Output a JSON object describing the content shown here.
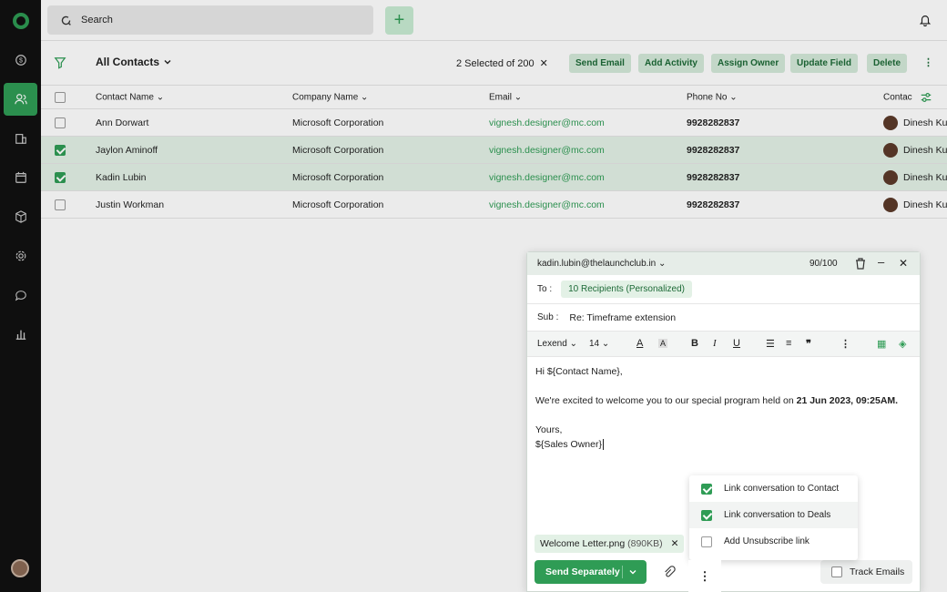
{
  "colors": {
    "accent": "#2f9c55",
    "sidebar": "#111111",
    "selected_row": "#e3f1e6"
  },
  "sidebar": {
    "items": [
      {
        "icon": "dollar-cycle-icon",
        "active": false
      },
      {
        "icon": "contacts-icon",
        "active": true
      },
      {
        "icon": "building-icon",
        "active": false
      },
      {
        "icon": "calendar-icon",
        "active": false
      },
      {
        "icon": "box-icon",
        "active": false
      },
      {
        "icon": "gear-icon",
        "active": false
      },
      {
        "icon": "chat-icon",
        "active": false
      },
      {
        "icon": "bar-chart-icon",
        "active": false
      }
    ]
  },
  "header": {
    "search_placeholder": "Search",
    "add_label": "+"
  },
  "toolbar": {
    "title": "All Contacts",
    "selection": "2 Selected of 200",
    "actions": [
      "Send Email",
      "Add Activity",
      "Assign Owner",
      "Update Field",
      "Delete"
    ]
  },
  "table": {
    "columns": [
      "Contact Name",
      "Company Name",
      "Email",
      "Phone No",
      "Contac"
    ],
    "rows": [
      {
        "name": "Ann Dorwart",
        "company": "Microsoft Corporation",
        "email": "vignesh.designer@mc.com",
        "phone": "9928282837",
        "owner": "Dinesh Ku",
        "checked": false
      },
      {
        "name": "Jaylon Aminoff",
        "company": "Microsoft Corporation",
        "email": "vignesh.designer@mc.com",
        "phone": "9928282837",
        "owner": "Dinesh Ku",
        "checked": true
      },
      {
        "name": "Kadin Lubin",
        "company": "Microsoft Corporation",
        "email": "vignesh.designer@mc.com",
        "phone": "9928282837",
        "owner": "Dinesh Ku",
        "checked": true
      },
      {
        "name": "Justin Workman",
        "company": "Microsoft Corporation",
        "email": "vignesh.designer@mc.com",
        "phone": "9928282837",
        "owner": "Dinesh Ku",
        "checked": false
      }
    ]
  },
  "compose": {
    "from": "kadin.lubin@thelaunchclub.in",
    "count": "90/100",
    "to_label": "To :",
    "recipients": "10 Recipients (Personalized)",
    "sub_label": "Sub :",
    "subject": "Re: Timeframe extension",
    "font": "Lexend",
    "size": "14",
    "greeting": "Hi ${Contact Name},",
    "line1": "We're excited to welcome you to our special program held on ",
    "line1_bold": "21 Jun 2023, 09:25AM.",
    "closing": "Yours,",
    "signature": "${Sales Owner}",
    "attachment": "Welcome Letter.png",
    "attachment_size": "(890KB)",
    "send_label": "Send Separately",
    "track_label": "Track Emails"
  },
  "popup": {
    "items": [
      {
        "label": "Link conversation to Contact",
        "checked": true
      },
      {
        "label": "Link conversation to Deals",
        "checked": true
      },
      {
        "label": "Add Unsubscribe link",
        "checked": false
      }
    ]
  }
}
